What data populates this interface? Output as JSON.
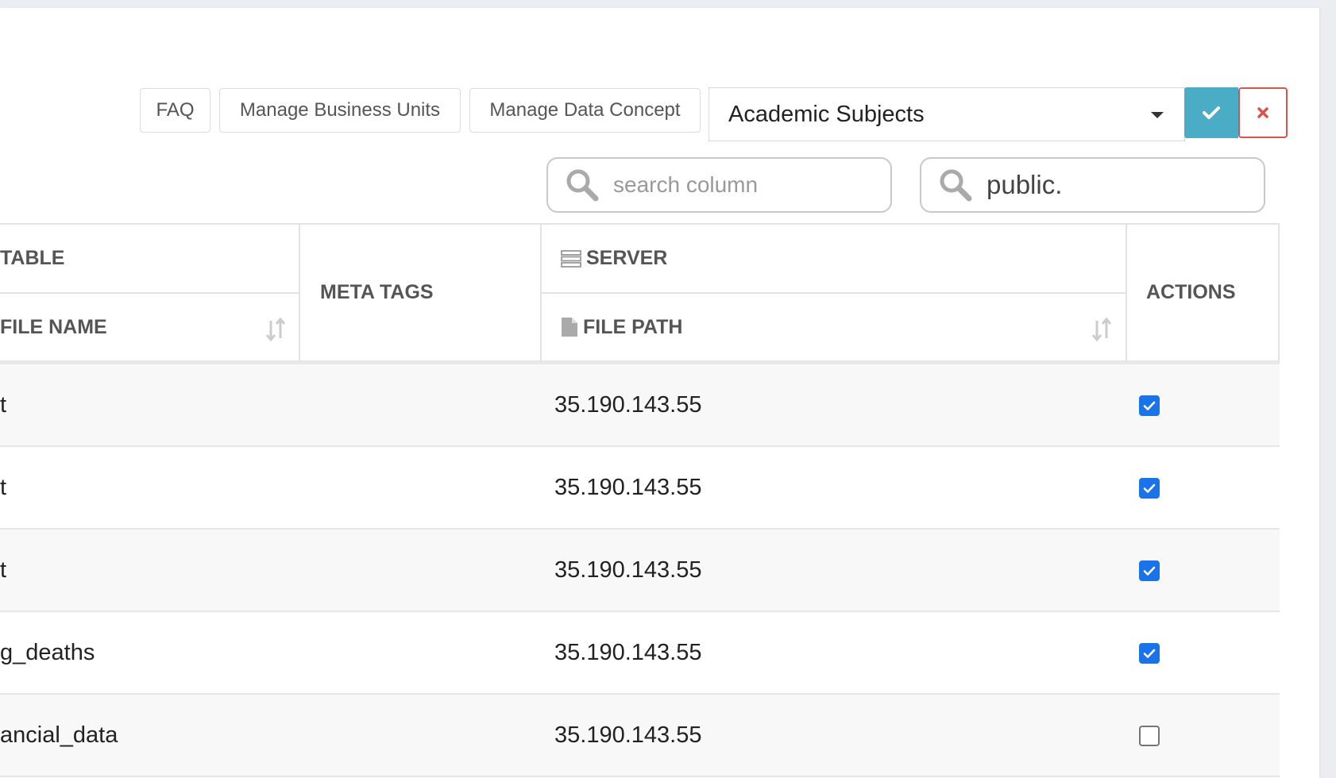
{
  "toolbar": {
    "faq_label": "FAQ",
    "manage_business_units_label": "Manage Business Units",
    "manage_data_concept_label": "Manage Data Concept",
    "subject_select_value": "Academic Subjects"
  },
  "search": {
    "column_placeholder": "search column",
    "table_value": "public."
  },
  "table": {
    "headers": {
      "table_group": "TABLE",
      "file_name": "FILE NAME",
      "meta_tags": "META TAGS",
      "server": "SERVER",
      "file_path": "FILE PATH",
      "actions": "ACTIONS"
    },
    "rows": [
      {
        "file_name": "t",
        "meta_tags": "",
        "server": "35.190.143.55",
        "checked": true
      },
      {
        "file_name": "t",
        "meta_tags": "",
        "server": "35.190.143.55",
        "checked": true
      },
      {
        "file_name": "t",
        "meta_tags": "",
        "server": "35.190.143.55",
        "checked": true
      },
      {
        "file_name": "g_deaths",
        "meta_tags": "",
        "server": "35.190.143.55",
        "checked": true
      },
      {
        "file_name": "ancial_data",
        "meta_tags": "",
        "server": "35.190.143.55",
        "checked": false
      }
    ]
  },
  "colors": {
    "confirm_bg": "#4bacc6",
    "cancel_border": "#d9534f",
    "checkbox_checked": "#1a73e8"
  },
  "icons": [
    "search-icon",
    "check-icon",
    "close-icon",
    "server-icon",
    "file-icon",
    "sort-icon",
    "caret-down-icon"
  ]
}
